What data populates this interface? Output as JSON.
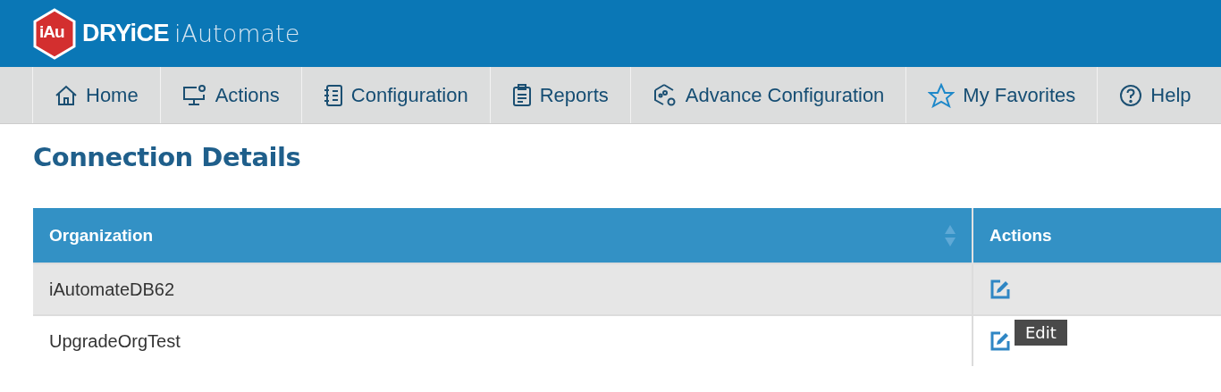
{
  "header": {
    "logo_badge": "iAu",
    "brand": "DRYiCE",
    "product": "iAutomate"
  },
  "nav": [
    {
      "label": "Home",
      "kind": "home"
    },
    {
      "label": "Actions",
      "kind": "actions"
    },
    {
      "label": "Configuration",
      "kind": "configuration"
    },
    {
      "label": "Reports",
      "kind": "reports"
    },
    {
      "label": "Advance Configuration",
      "kind": "advanced"
    },
    {
      "label": "My Favorites",
      "kind": "favorites"
    },
    {
      "label": "Help",
      "kind": "help"
    }
  ],
  "page_title": "Connection Details",
  "table": {
    "columns": [
      {
        "label": "Organization",
        "sortable": true
      },
      {
        "label": "Actions",
        "sortable": false
      }
    ],
    "rows": [
      {
        "organization": "iAutomateDB62"
      },
      {
        "organization": "UpgradeOrgTest",
        "tooltip": "Edit"
      }
    ]
  }
}
